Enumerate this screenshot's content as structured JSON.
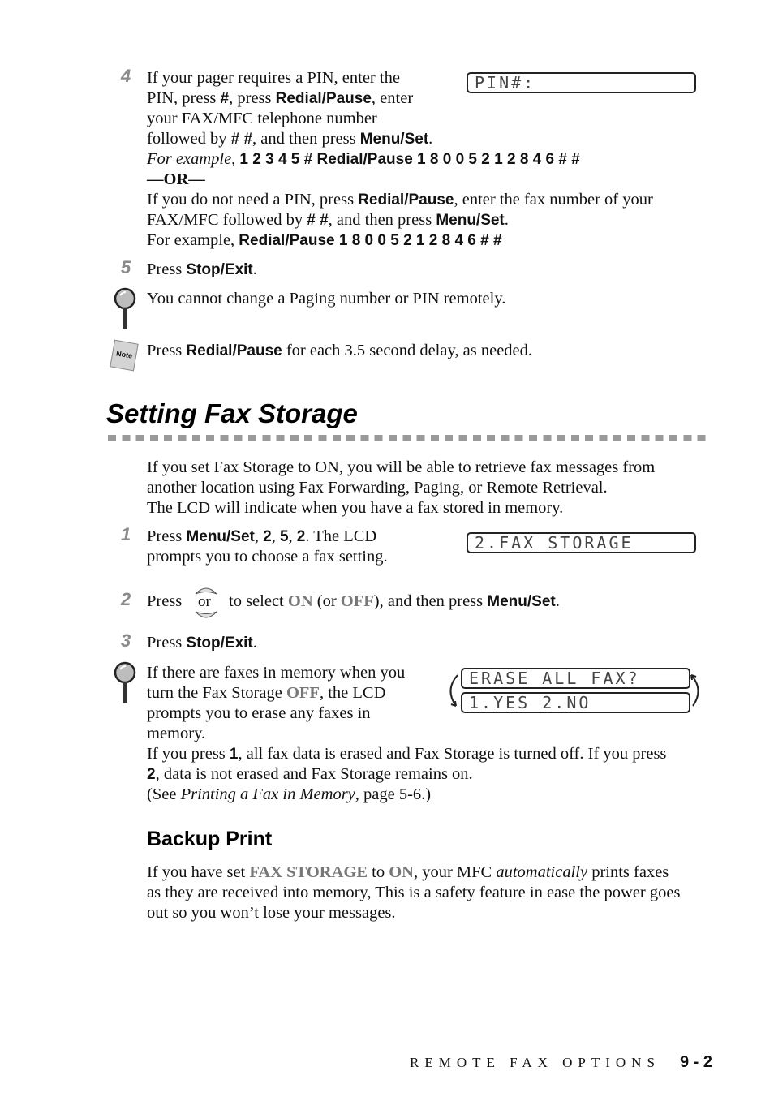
{
  "step4": {
    "number": "4",
    "line1": "If your pager requires a PIN, enter the",
    "line2_a": "PIN, press ",
    "line2_b": "#",
    "line2_c": ", press ",
    "line2_d": "Redial/Pause",
    "line2_e": ", enter",
    "line3": "your FAX/MFC telephone number",
    "line4_a": "followed by ",
    "line4_b": "# #",
    "line4_c": ", and then press ",
    "line4_d": "Menu/Set",
    "line4_e": ".",
    "example_label": "For example",
    "example_sep": ", ",
    "example_keys": "1 2 3 4 5 # Redial/Pause 1 8 0 0 5 2 1 2 8 4 6 # #",
    "or_label": "—OR—",
    "alt1_a": "If you do not need a PIN, press ",
    "alt1_b": "Redial/Pause",
    "alt1_c": ", enter the fax number of your",
    "alt2_a": "FAX/MFC followed by ",
    "alt2_b": "# #",
    "alt2_c": ", and then press ",
    "alt2_d": "Menu/Set",
    "alt2_e": ".",
    "alt3_a": "For example, ",
    "alt3_b": "Redial/Pause 1 8 0 0 5 2 1 2 8 4 6 # #",
    "lcd": "PIN#:"
  },
  "step5": {
    "number": "5",
    "text_a": "Press ",
    "text_b": "Stop/Exit",
    "text_c": "."
  },
  "tip1": {
    "icon": "magnifier-icon",
    "text": "You cannot change a Paging number or PIN remotely."
  },
  "note1": {
    "icon": "note-icon",
    "icon_label": "Note",
    "text_a": "Press ",
    "text_b": "Redial/Pause",
    "text_c": " for each 3.5 second delay, as needed."
  },
  "section": {
    "title": "Setting Fax Storage",
    "intro1": "If you set Fax Storage to ON, you will be able to retrieve fax messages from",
    "intro2": "another location using Fax Forwarding, Paging, or Remote Retrieval.",
    "intro3": "The LCD will indicate when you have a fax stored in memory."
  },
  "fs_step1": {
    "number": "1",
    "a": "Press ",
    "b": "Menu/Set",
    "c": ", ",
    "d": "2",
    "e": ", ",
    "f": "5",
    "g": ", ",
    "h": "2",
    "i": ".  The LCD",
    "line2": "prompts you to choose a fax setting.",
    "lcd": "2.FAX STORAGE"
  },
  "fs_step2": {
    "number": "2",
    "a": "Press",
    "button_label": "or",
    "b": "to select ",
    "on": "ON",
    "c": " (or ",
    "off": "OFF",
    "d": "), and then press ",
    "e": "Menu/Set",
    "f": "."
  },
  "fs_step3": {
    "number": "3",
    "a": "Press ",
    "b": "Stop/Exit",
    "c": "."
  },
  "tip2": {
    "icon": "magnifier-icon",
    "line1": "If there are faxes in memory when you",
    "line2_a": "turn the Fax Storage ",
    "line2_b": "OFF",
    "line2_c": ", the LCD",
    "line3": "prompts you to erase any faxes in",
    "line4": "memory.",
    "line5_a": "If you press ",
    "line5_b": "1",
    "line5_c": ", all fax data is erased and Fax Storage is turned off.  If you press",
    "line6_a": "2",
    "line6_b": ", data is not erased and Fax Storage remains on.",
    "line7_a": "(See ",
    "line7_b": "Printing a Fax in Memory",
    "line7_c": ", page 5-6.)",
    "lcd_line1": "ERASE ALL FAX?",
    "lcd_line2": "1.YES 2.NO"
  },
  "backup": {
    "title": "Backup Print",
    "l1_a": "If you have set ",
    "l1_b": "FAX STORAGE",
    "l1_c": " to ",
    "l1_d": "ON",
    "l1_e": ", your MFC ",
    "l1_f": "automatically",
    "l1_g": " prints faxes",
    "l2": "as they are received into memory, This is a safety feature in ease the power goes",
    "l3": "out so you won’t lose your messages."
  },
  "footer": {
    "chapter": "REMOTE FAX OPTIONS",
    "page": "9 - 2"
  }
}
